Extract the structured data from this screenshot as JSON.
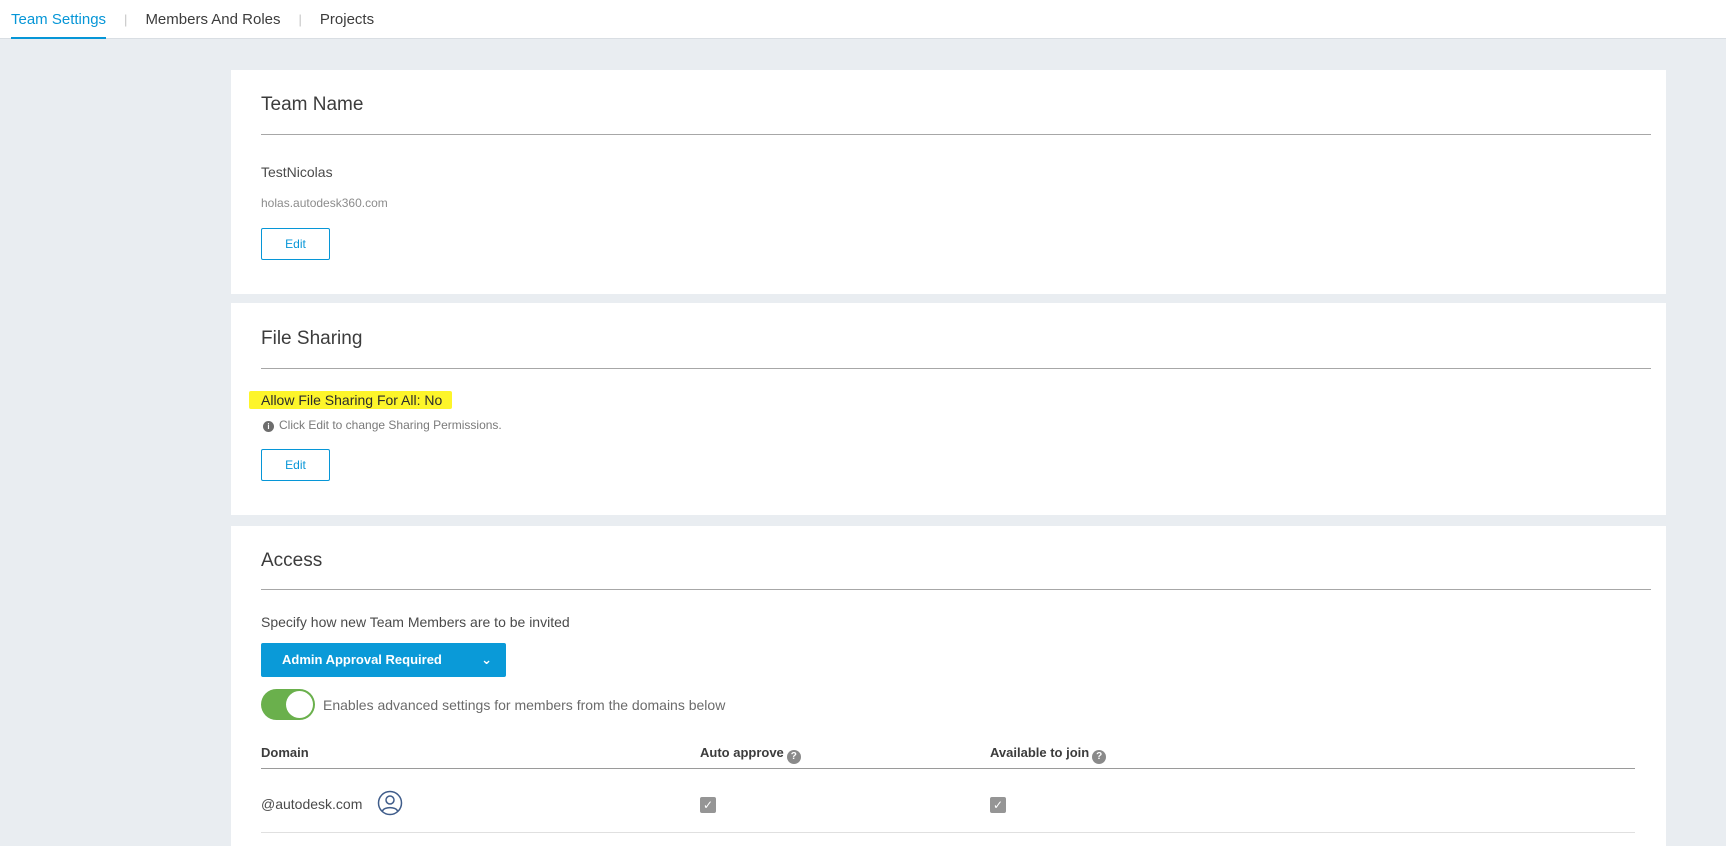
{
  "nav": {
    "tabs": [
      {
        "label": "Team Settings",
        "active": true
      },
      {
        "label": "Members And Roles",
        "active": false
      },
      {
        "label": "Projects",
        "active": false
      }
    ],
    "separator": "|"
  },
  "team_name": {
    "title": "Team Name",
    "name": "TestNicolas",
    "url": "holas.autodesk360.com",
    "edit_label": "Edit"
  },
  "file_sharing": {
    "title": "File Sharing",
    "status": "Allow File Sharing For All: No",
    "hint_icon": "info-icon",
    "hint": "Click Edit to change Sharing Permissions.",
    "edit_label": "Edit"
  },
  "access": {
    "title": "Access",
    "instruction": "Specify how new Team Members are to be invited",
    "dropdown_value": "Admin Approval Required",
    "toggle_on": true,
    "toggle_label": "Enables advanced settings for members from the domains below",
    "columns": [
      "Domain",
      "Auto approve",
      "Available to join"
    ],
    "rows": [
      {
        "domain": "@autodesk.com",
        "auto_approve": true,
        "available_to_join": true
      }
    ]
  },
  "colors": {
    "accent": "#0696d7",
    "toggle": "#6ab04c",
    "highlight": "#fdf52a",
    "background": "#e9edf1"
  }
}
